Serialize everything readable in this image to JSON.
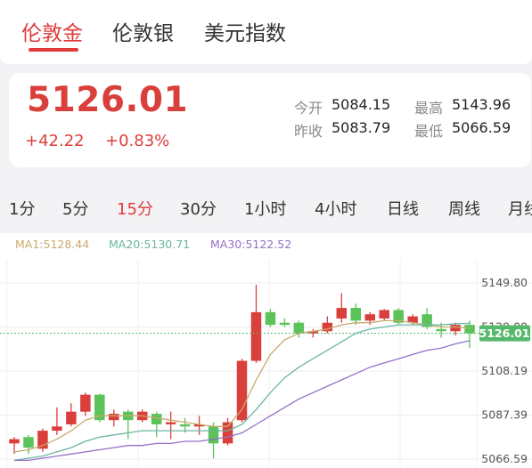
{
  "tabs": [
    {
      "label": "伦敦金",
      "active": true
    },
    {
      "label": "伦敦银",
      "active": false
    },
    {
      "label": "美元指数",
      "active": false
    }
  ],
  "quote": {
    "price": "5126.01",
    "change": "+42.22",
    "change_pct": "+0.83%",
    "open_label": "今开",
    "open": "5084.15",
    "high_label": "最高",
    "high": "5143.96",
    "prev_close_label": "昨收",
    "prev_close": "5083.79",
    "low_label": "最低",
    "low": "5066.59"
  },
  "periods": [
    {
      "label": "1分",
      "active": false
    },
    {
      "label": "5分",
      "active": false
    },
    {
      "label": "15分",
      "active": true
    },
    {
      "label": "30分",
      "active": false
    },
    {
      "label": "1小时",
      "active": false
    },
    {
      "label": "4小时",
      "active": false
    },
    {
      "label": "日线",
      "active": false
    },
    {
      "label": "周线",
      "active": false
    },
    {
      "label": "月线",
      "active": false
    }
  ],
  "indicators": {
    "ma1": "MA1:5128.44",
    "ma20": "MA20:5130.71",
    "ma30": "MA30:5122.52"
  },
  "colors": {
    "up": "#d9403b",
    "down": "#5cc25a",
    "ma1": "#c8aa6e",
    "ma20": "#6ab5a2",
    "ma30": "#9370c7",
    "current": "#55b86a"
  },
  "chart_data": {
    "type": "candlestick",
    "ylim": [
      5066.59,
      5149.8
    ],
    "y_ticks": [
      "5149.80",
      "5129.00",
      "5108.19",
      "5087.39",
      "5066.59"
    ],
    "current_price": "5126.01",
    "candles": [
      {
        "o": 5074.0,
        "h": 5077.0,
        "l": 5069.0,
        "c": 5076.0
      },
      {
        "o": 5077.0,
        "h": 5078.0,
        "l": 5069.0,
        "c": 5072.0
      },
      {
        "o": 5071.5,
        "h": 5081.0,
        "l": 5070.0,
        "c": 5080.0
      },
      {
        "o": 5080.0,
        "h": 5091.0,
        "l": 5078.0,
        "c": 5082.0
      },
      {
        "o": 5083.0,
        "h": 5093.0,
        "l": 5082.0,
        "c": 5089.0
      },
      {
        "o": 5089.0,
        "h": 5098.0,
        "l": 5087.0,
        "c": 5097.0
      },
      {
        "o": 5097.0,
        "h": 5097.5,
        "l": 5084.0,
        "c": 5085.0
      },
      {
        "o": 5085.0,
        "h": 5090.0,
        "l": 5082.0,
        "c": 5088.0
      },
      {
        "o": 5089.0,
        "h": 5090.0,
        "l": 5076.0,
        "c": 5085.0
      },
      {
        "o": 5085.0,
        "h": 5090.0,
        "l": 5084.0,
        "c": 5089.0
      },
      {
        "o": 5088.0,
        "h": 5089.0,
        "l": 5077.0,
        "c": 5083.0
      },
      {
        "o": 5083.0,
        "h": 5089.0,
        "l": 5076.0,
        "c": 5084.0
      },
      {
        "o": 5083.0,
        "h": 5086.0,
        "l": 5079.0,
        "c": 5082.0
      },
      {
        "o": 5082.0,
        "h": 5087.0,
        "l": 5078.0,
        "c": 5083.0
      },
      {
        "o": 5082.0,
        "h": 5084.0,
        "l": 5067.0,
        "c": 5074.0
      },
      {
        "o": 5074.0,
        "h": 5086.0,
        "l": 5073.0,
        "c": 5084.0
      },
      {
        "o": 5085.0,
        "h": 5114.0,
        "l": 5084.0,
        "c": 5113.0
      },
      {
        "o": 5113.0,
        "h": 5149.0,
        "l": 5112.0,
        "c": 5136.0
      },
      {
        "o": 5136.0,
        "h": 5137.5,
        "l": 5129.0,
        "c": 5130.0
      },
      {
        "o": 5131.0,
        "h": 5133.0,
        "l": 5129.0,
        "c": 5130.0
      },
      {
        "o": 5131.0,
        "h": 5132.0,
        "l": 5124.0,
        "c": 5126.0
      },
      {
        "o": 5126.0,
        "h": 5128.0,
        "l": 5124.0,
        "c": 5127.0
      },
      {
        "o": 5127.0,
        "h": 5134.0,
        "l": 5126.0,
        "c": 5131.0
      },
      {
        "o": 5133.0,
        "h": 5145.0,
        "l": 5131.0,
        "c": 5138.0
      },
      {
        "o": 5138.0,
        "h": 5140.0,
        "l": 5130.0,
        "c": 5132.0
      },
      {
        "o": 5132.0,
        "h": 5136.0,
        "l": 5130.0,
        "c": 5135.0
      },
      {
        "o": 5133.0,
        "h": 5137.5,
        "l": 5132.0,
        "c": 5137.0
      },
      {
        "o": 5137.0,
        "h": 5138.0,
        "l": 5130.0,
        "c": 5131.0
      },
      {
        "o": 5131.0,
        "h": 5135.0,
        "l": 5130.0,
        "c": 5134.0
      },
      {
        "o": 5135.0,
        "h": 5138.0,
        "l": 5128.0,
        "c": 5129.0
      },
      {
        "o": 5128.0,
        "h": 5131.0,
        "l": 5124.0,
        "c": 5127.0
      },
      {
        "o": 5127.0,
        "h": 5131.0,
        "l": 5125.0,
        "c": 5130.0
      },
      {
        "o": 5130.0,
        "h": 5132.0,
        "l": 5119.0,
        "c": 5126.0
      }
    ],
    "ma1": [
      5070,
      5071,
      5073,
      5076,
      5080,
      5085,
      5087,
      5087,
      5087,
      5087,
      5086,
      5085,
      5084,
      5083,
      5082,
      5082,
      5090,
      5104,
      5116,
      5123,
      5126,
      5127,
      5128,
      5130,
      5131,
      5131,
      5132,
      5132,
      5131,
      5130,
      5129,
      5129,
      5128.44
    ],
    "ma20": [
      5066,
      5067,
      5068,
      5070,
      5072,
      5075,
      5077,
      5078,
      5079,
      5080,
      5080,
      5080,
      5080,
      5080,
      5080,
      5080,
      5083,
      5090,
      5098,
      5105,
      5110,
      5114,
      5118,
      5122,
      5126,
      5128,
      5129,
      5130,
      5130,
      5130,
      5130,
      5130.5,
      5130.71
    ],
    "ma30": [
      5066,
      5066,
      5067,
      5068,
      5069,
      5070,
      5071,
      5072,
      5073,
      5073,
      5074,
      5074,
      5075,
      5075,
      5076,
      5077,
      5079,
      5083,
      5087,
      5091,
      5095,
      5098,
      5101,
      5104,
      5107,
      5110,
      5112,
      5114,
      5116,
      5118,
      5119,
      5121,
      5122.52
    ]
  }
}
